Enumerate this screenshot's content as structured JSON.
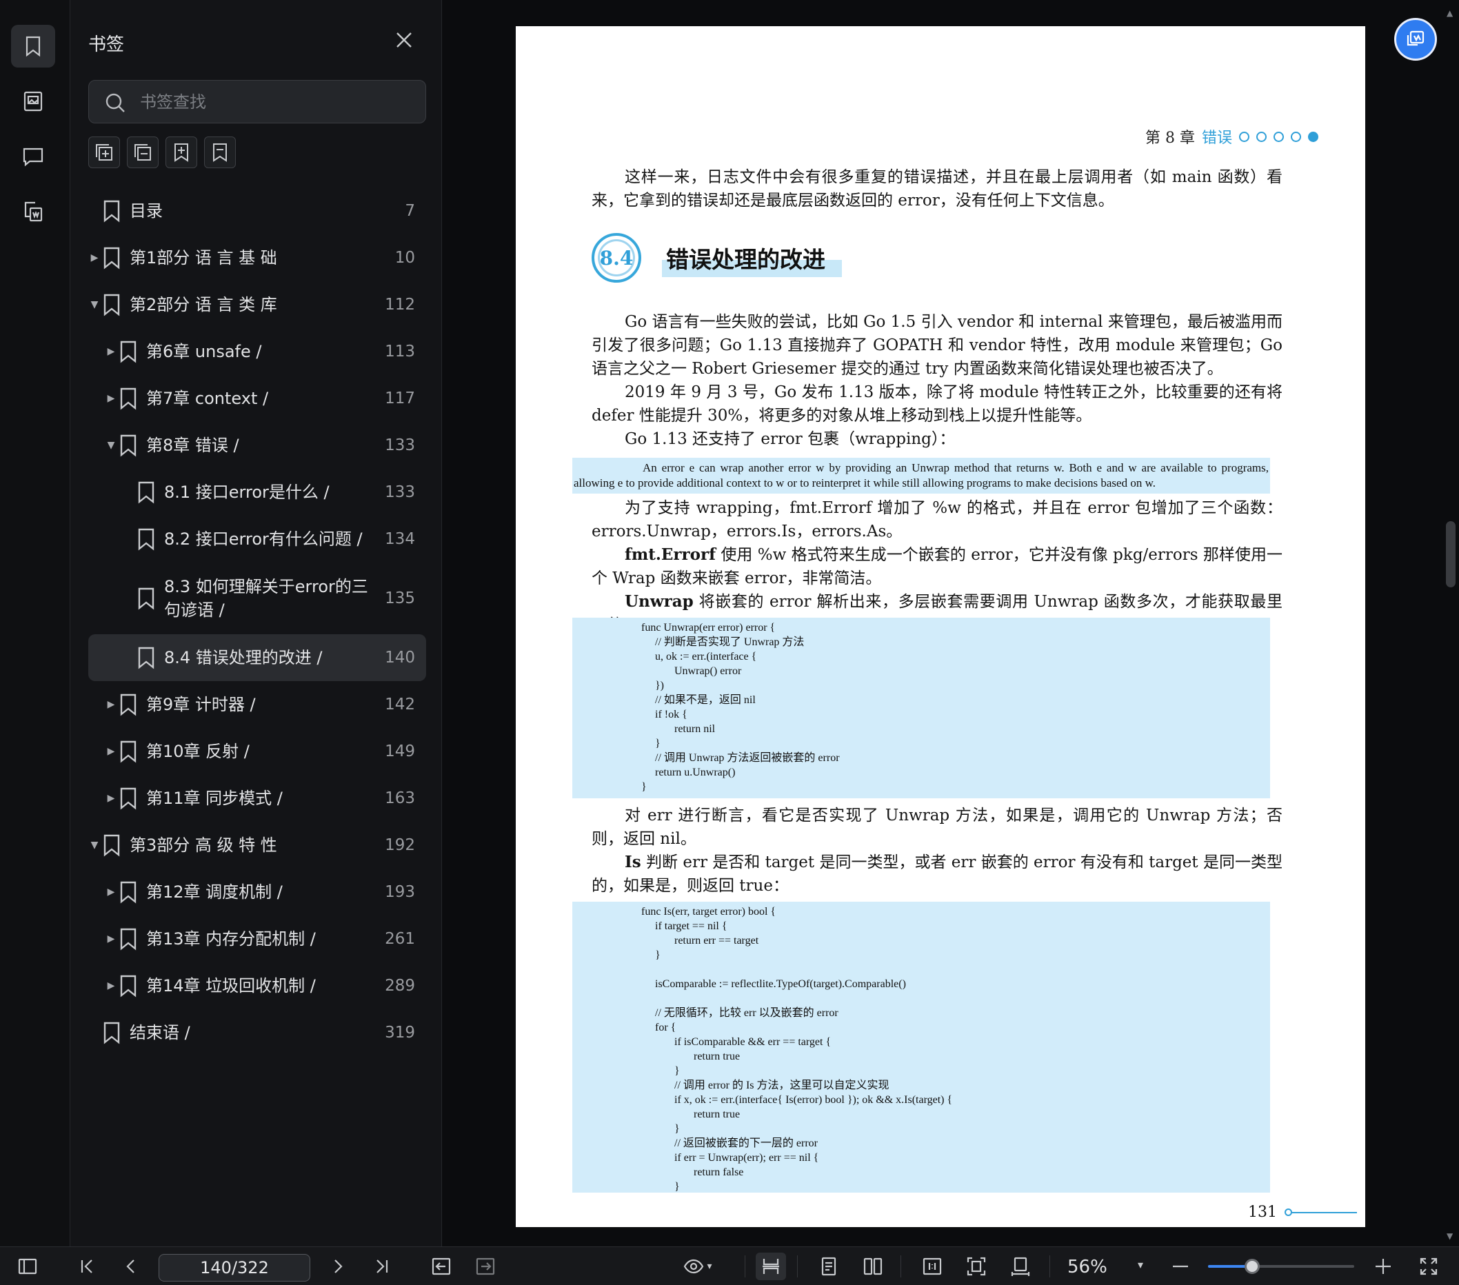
{
  "panel": {
    "title": "书签",
    "search_placeholder": "书签查找"
  },
  "bookmarks": [
    {
      "label": "目录",
      "page": "7",
      "level": 0,
      "caret": "none"
    },
    {
      "label": "第1部分 语 言 基 础",
      "page": "10",
      "level": 0,
      "caret": "collapsed"
    },
    {
      "label": "第2部分 语 言 类 库",
      "page": "112",
      "level": 0,
      "caret": "expanded"
    },
    {
      "label": "第6章 unsafe /",
      "page": "113",
      "level": 1,
      "caret": "collapsed"
    },
    {
      "label": "第7章 context /",
      "page": "117",
      "level": 1,
      "caret": "collapsed"
    },
    {
      "label": "第8章 错误 /",
      "page": "133",
      "level": 1,
      "caret": "expanded"
    },
    {
      "label": "8.1 接口error是什么 /",
      "page": "133",
      "level": 2,
      "caret": "none"
    },
    {
      "label": "8.2 接口error有什么问题 /",
      "page": "134",
      "level": 2,
      "caret": "none"
    },
    {
      "label": "8.3 如何理解关于error的三\n句谚语 /",
      "page": "135",
      "level": 2,
      "caret": "none"
    },
    {
      "label": "8.4 错误处理的改进 /",
      "page": "140",
      "level": 2,
      "caret": "none",
      "selected": true
    },
    {
      "label": "第9章 计时器 /",
      "page": "142",
      "level": 1,
      "caret": "collapsed"
    },
    {
      "label": "第10章 反射 /",
      "page": "149",
      "level": 1,
      "caret": "collapsed"
    },
    {
      "label": "第11章 同步模式 /",
      "page": "163",
      "level": 1,
      "caret": "collapsed"
    },
    {
      "label": "第3部分 高 级 特 性",
      "page": "192",
      "level": 0,
      "caret": "expanded"
    },
    {
      "label": "第12章 调度机制 /",
      "page": "193",
      "level": 1,
      "caret": "collapsed"
    },
    {
      "label": "第13章 内存分配机制 /",
      "page": "261",
      "level": 1,
      "caret": "collapsed"
    },
    {
      "label": "第14章 垃圾回收机制 /",
      "page": "289",
      "level": 1,
      "caret": "collapsed"
    },
    {
      "label": "结束语 /",
      "page": "319",
      "level": 0,
      "caret": "none"
    }
  ],
  "document": {
    "running_head_chapter": "第 8 章",
    "running_head_section": "错误",
    "para_intro": "这样一来，日志文件中会有很多重复的错误描述，并且在最上层调用者（如 main 函数）看来，它拿到的错误却还是最底层函数返回的 error，没有任何上下文信息。",
    "section_number": "8.4",
    "section_title": "错误处理的改进",
    "para_1": "Go 语言有一些失败的尝试，比如 Go 1.5 引入 vendor 和 internal 来管理包，最后被滥用而引发了很多问题；Go 1.13 直接抛弃了 GOPATH 和 vendor 特性，改用 module 来管理包；Go 语言之父之一 Robert Griesemer 提交的通过 try 内置函数来简化错误处理也被否决了。",
    "para_2": "2019 年 9 月 3 号，Go 发布 1.13 版本，除了将 module 特性转正之外，比较重要的还有将 defer 性能提升 30%，将更多的对象从堆上移动到栈上以提升性能等。",
    "para_3": "Go 1.13 还支持了 error 包裹（wrapping）：",
    "quote": "An error e can wrap another error w by providing an Unwrap method that returns w. Both e and w are available to programs, allowing e to provide additional context to w or to reinterpret it while still allowing programs to make decisions based on w.",
    "para_4": "为了支持 wrapping，fmt.Errorf 增加了 %w 的格式，并且在 error 包增加了三个函数：errors.Unwrap，errors.Is，errors.As。",
    "para_5_bold": "fmt.Errorf",
    "para_5": " 使用 %w 格式符来生成一个嵌套的 error，它并没有像 pkg/errors 那样使用一个 Wrap 函数来嵌套 error，非常简洁。",
    "para_6_bold": "Unwrap",
    "para_6": " 将嵌套的 error 解析出来，多层嵌套需要调用 Unwrap 函数多次，才能获取最里层的 error：",
    "code_1": "func Unwrap(err error) error {\n     // 判断是否实现了 Unwrap 方法\n     u, ok := err.(interface {\n            Unwrap() error\n     })\n     // 如果不是，返回 nil\n     if !ok {\n            return nil\n     }\n     // 调用 Unwrap 方法返回被嵌套的 error\n     return u.Unwrap()\n}",
    "para_7": "对 err 进行断言，看它是否实现了 Unwrap 方法，如果是，调用它的 Unwrap 方法；否则，返回 nil。",
    "para_8_bold": "Is",
    "para_8": " 判断 err 是否和 target 是同一类型，或者 err 嵌套的 error 有没有和 target 是同一类型的，如果是，则返回 true：",
    "code_2": "func Is(err, target error) bool {\n     if target == nil {\n            return err == target\n     }\n\n     isComparable := reflectlite.TypeOf(target).Comparable()\n\n     // 无限循环，比较 err 以及嵌套的 error\n     for {\n            if isComparable && err == target {\n                   return true\n            }\n            // 调用 error 的 Is 方法，这里可以自定义实现\n            if x, ok := err.(interface{ Is(error) bool }); ok && x.Is(target) {\n                   return true\n            }\n            // 返回被嵌套的下一层的 error\n            if err = Unwrap(err); err == nil {\n                   return false\n            }",
    "page_number": "131"
  },
  "toolbar": {
    "page_value": "140/322",
    "zoom": "56%",
    "zoom_fraction": 0.3
  },
  "colors": {
    "accent": "#2f9fd8",
    "highlight": "#d2ecfa",
    "float_button": "#2f7cf0"
  }
}
